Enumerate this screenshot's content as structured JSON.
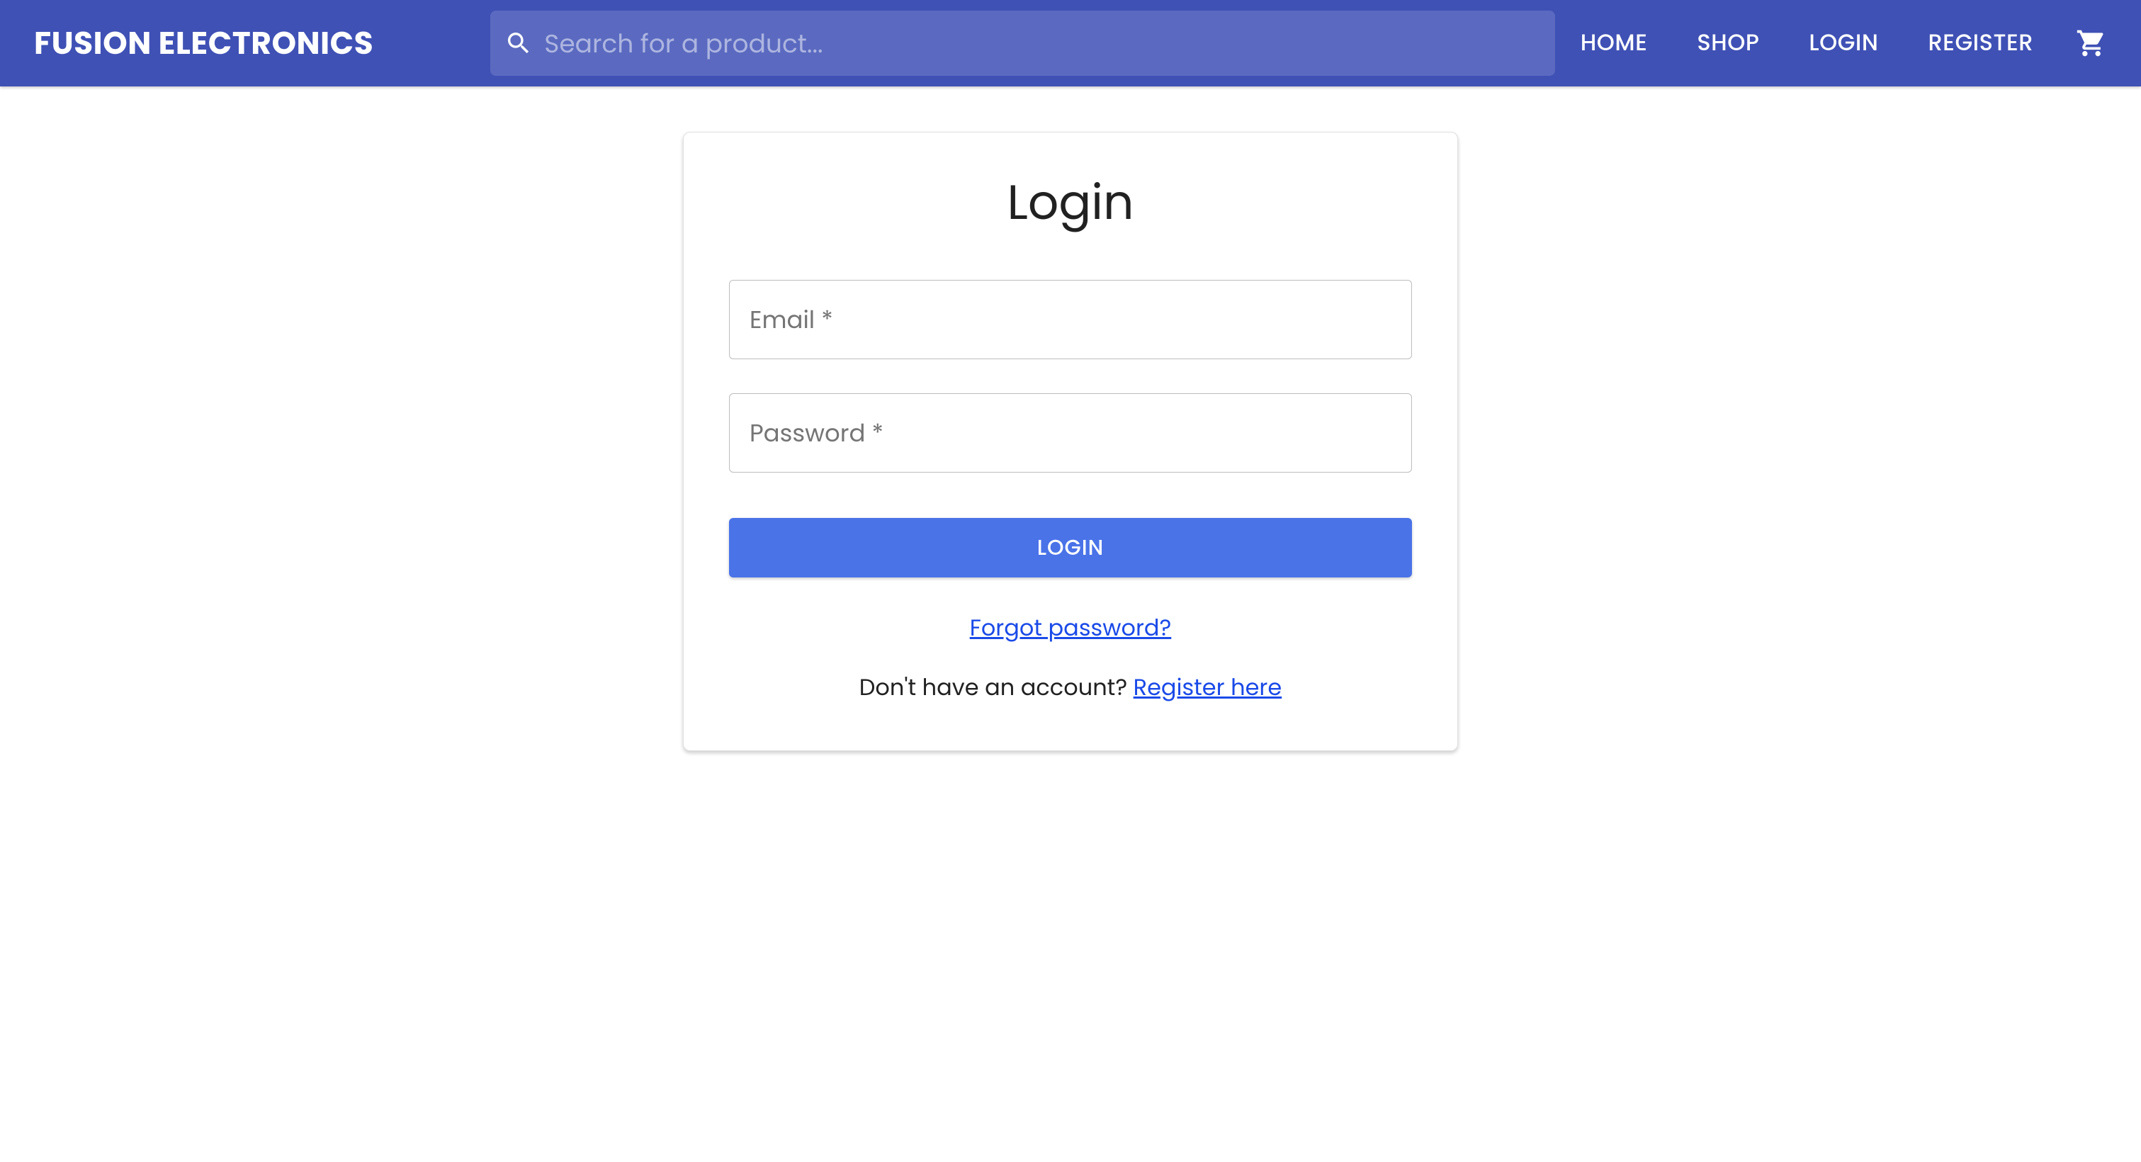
{
  "header": {
    "brand": "FUSION ELECTRONICS",
    "search_placeholder": "Search for a product...",
    "nav": {
      "home": "HOME",
      "shop": "SHOP",
      "login": "LOGIN",
      "register": "REGISTER"
    }
  },
  "login_card": {
    "title": "Login",
    "email_label": "Email *",
    "password_label": "Password *",
    "submit_label": "LOGIN",
    "forgot_link": "Forgot password?",
    "no_account_text": "Don't have an account? ",
    "register_link": "Register here"
  }
}
